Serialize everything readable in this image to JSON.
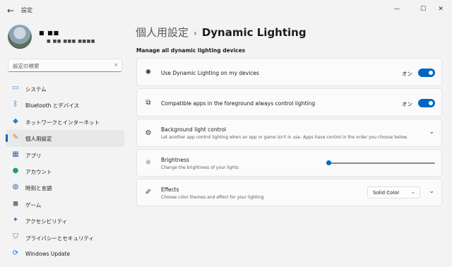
{
  "window": {
    "title": "設定",
    "back_icon": "arrow-left-icon",
    "minimize_glyph": "—",
    "maximize_glyph": "☐",
    "close_glyph": "✕"
  },
  "profile": {
    "name": "■ ■■",
    "email": "■ ■■ ■■■ ■■■■"
  },
  "search": {
    "placeholder": "設定の検索",
    "icon": "search-icon"
  },
  "sidebar": {
    "items": [
      {
        "label": "システム",
        "icon": "monitor-icon",
        "glyph": "▭",
        "color": "#2b88d8",
        "active": false
      },
      {
        "label": "Bluetooth とデバイス",
        "icon": "bluetooth-icon",
        "glyph": "ᛒ",
        "color": "#0a66c2",
        "active": false
      },
      {
        "label": "ネットワークとインターネット",
        "icon": "wifi-icon",
        "glyph": "◆",
        "color": "#2b7bd6",
        "active": false
      },
      {
        "label": "個人用設定",
        "icon": "paintbrush-icon",
        "glyph": "✎",
        "color": "#c97a2b",
        "active": true
      },
      {
        "label": "アプリ",
        "icon": "apps-icon",
        "glyph": "▦",
        "color": "#3a6ea5",
        "active": false
      },
      {
        "label": "アカウント",
        "icon": "person-icon",
        "glyph": "●",
        "color": "#1f9e6e",
        "active": false
      },
      {
        "label": "時刻と言語",
        "icon": "globe-clock-icon",
        "glyph": "◍",
        "color": "#2d6db5",
        "active": false
      },
      {
        "label": "ゲーム",
        "icon": "gamepad-icon",
        "glyph": "◼",
        "color": "#7a7a7a",
        "active": false
      },
      {
        "label": "アクセシビリティ",
        "icon": "accessibility-icon",
        "glyph": "✦",
        "color": "#1a73e8",
        "active": false
      },
      {
        "label": "プライバシーとセキュリティ",
        "icon": "shield-icon",
        "glyph": "⛉",
        "color": "#5b6b7a",
        "active": false
      },
      {
        "label": "Windows Update",
        "icon": "sync-icon",
        "glyph": "⟳",
        "color": "#1a73e8",
        "active": false
      }
    ]
  },
  "breadcrumb": {
    "parent": "個人用設定",
    "separator": "›",
    "current": "Dynamic Lighting"
  },
  "section_title": "Manage all dynamic lighting devices",
  "cards": {
    "use_dynamic": {
      "title": "Use Dynamic Lighting on my devices",
      "state_label": "オン",
      "on": true,
      "icon": "sun-rays-icon",
      "glyph": "✺"
    },
    "compatible_apps": {
      "title": "Compatible apps in the foreground always control lighting",
      "state_label": "オン",
      "on": true,
      "icon": "apps-layers-icon",
      "glyph": "⧉"
    },
    "background": {
      "title": "Background light control",
      "description": "Let another app control lighting when an app or game isn't in use. Apps have control in the order you choose below.",
      "icon": "gear-icon",
      "glyph": "⚙",
      "chevron": "⌄"
    },
    "brightness": {
      "title": "Brightness",
      "description": "Change the brightness of your lights",
      "icon": "brightness-icon",
      "glyph": "☼",
      "value_fraction": 0.0
    },
    "effects": {
      "title": "Effects",
      "description": "Choose color themes and effect for your lighting",
      "icon": "brush-icon",
      "glyph": "✐",
      "selected": "Solid Color",
      "chevron": "⌄"
    }
  },
  "colors": {
    "accent": "#0067c0",
    "background": "#f3f3f3",
    "card": "#fbfbfb"
  }
}
